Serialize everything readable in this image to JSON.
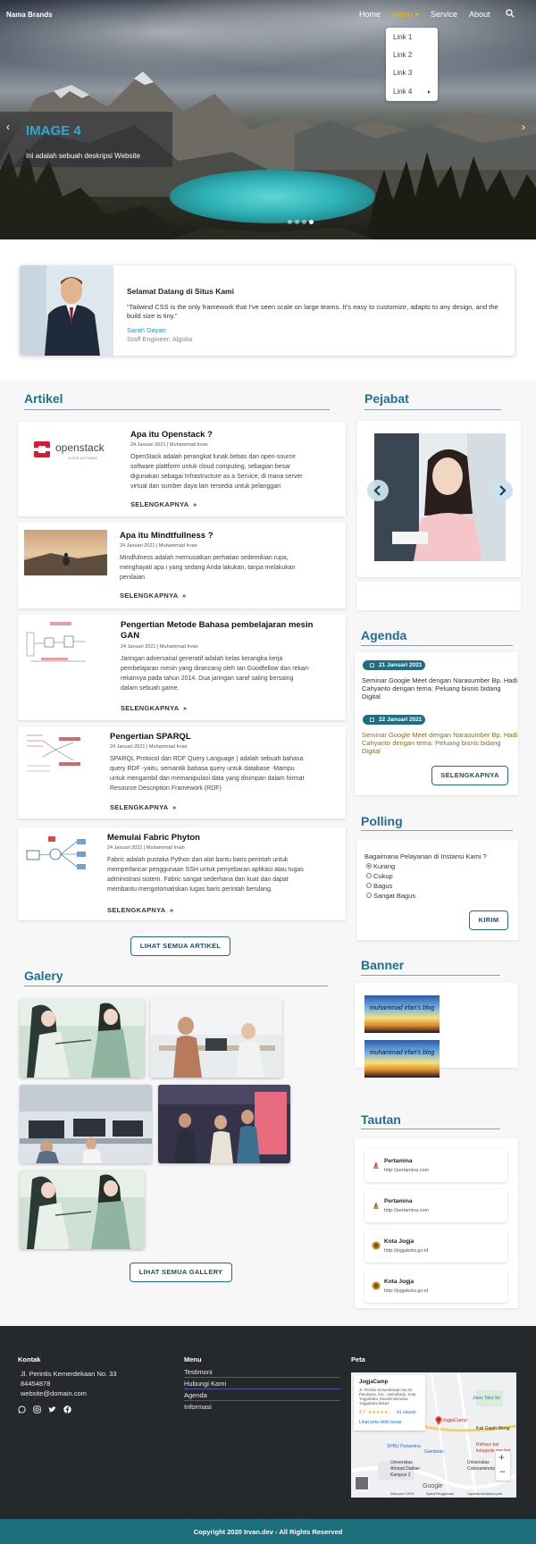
{
  "navbar": {
    "brand": "Nama Brands",
    "links": [
      "Home",
      "Menu",
      "Service",
      "About"
    ],
    "dropdown": [
      "Link 1",
      "Link 2",
      "Link 3",
      "Link 4"
    ]
  },
  "hero": {
    "title": "IMAGE 4",
    "description": "Ini adalah sebuah deskripsi Website",
    "prev": "‹",
    "next": "›",
    "slide_count": 4,
    "active_slide": 4
  },
  "welcome": {
    "title": "Selamat Datang di Situs Kami",
    "quote": "“Tailwind CSS is the only framework that I've seen scale on large teams. It’s easy to customize, adapts to any design, and the build size is tiny.”",
    "name": "Sarah Dayan",
    "role": "Staff Engineer, Algolia"
  },
  "articles_section": {
    "heading": "Artikel",
    "more_label": "SELENGKAPNYA",
    "more_icon": "»",
    "all_button": "LIHAT SEMUA ARTIKEL",
    "items": [
      {
        "title": "Apa itu Openstack ?",
        "meta": "24 Januari 2021 | Muhammad Irvan",
        "desc_lines": [
          "OpenStack adalah perangkat lunak bebas dan open-source",
          "software plattform untuk cloud computing, sebagian besar",
          "digunakan sebagai Infrastructure as a Service, di mana server",
          "virtual dan sumber daya lain tersedia untuk pelanggan"
        ],
        "image": "openstack-logo",
        "logo_text": "openstack",
        "logo_sub": "CLOUD SOFTWARE",
        "more": "SELENGKAPNYA"
      },
      {
        "title": "Apa itu Mindtfullness ?",
        "meta": "24 Januari 2021 | Muhammad Irvan",
        "desc_lines": [
          "Mindfulness adalah memusatkan perhatian sedemikian rupa,",
          "menghayati apa i yang sedang Anda lakukan, tanpa melakukan",
          "penilaian"
        ],
        "image": "meditation-photo",
        "more": "SELENGKAPNYA"
      },
      {
        "title_lines": [
          "Pengertian Metode Bahasa pembelajaran mesin",
          "GAN"
        ],
        "meta": "24 Januari 2021 | Muhammad Irvan",
        "desc_lines": [
          "Jaringan adversarial generatif adalah kelas kerangka kerja",
          "pembelajaran mesin yang dirancang oleh Ian Goodfellow dan rekan-",
          "rekannya pada tahun 2014. Dua jaringan saraf saling bersaing",
          "dalam sebuah game."
        ],
        "image": "gan-diagram",
        "more": "SELENGKAPNYA"
      },
      {
        "title": "Pengertian SPARQL",
        "meta": "24 Januari 2021 | Muhammad Irvan",
        "desc_lines": [
          "SPARQL Protocol dan RDF Query Language ) adalah sebuah bahasa",
          "query RDF -yaitu, semantik bahasa query untuk database -Mampu",
          "untuk mengambil dan memanipulasi data yang disimpan dalam format",
          "Resource Description Framework (RDF)"
        ],
        "image": "sparql-diagram",
        "more": "SELENGKAPNYA"
      },
      {
        "title": "Memulai Fabric Phyton",
        "meta": "24 Januari 2021 | Muhammad Irvan",
        "desc_lines": [
          "Fabric adalah pustaka Python dan alat bantu baris perintah untuk",
          "memperlancar penggunaan SSH untuk penyebaran aplikasi atau tugas",
          "administrasi sistem. Fabric sangat sederhana dan kuat dan dapat",
          "membantu mengotomatiskan tugas baris perintah berulang."
        ],
        "image": "fabric-diagram",
        "more": "SELENGKAPNYA"
      }
    ]
  },
  "gallery": {
    "heading": "Galery",
    "all_button": "LIHAT SEMUA GALLERY"
  },
  "pejabat": {
    "heading": "Pejabat"
  },
  "agenda": {
    "heading": "Agenda",
    "items": [
      {
        "date": "21 Januari 2021",
        "text_lines": [
          "Seminar Google Meet dengan Narasumber Bp. Hadi",
          "Cahyanto dengan tema: Peluang bisnis bidang",
          "Digital"
        ],
        "color": "#333333"
      },
      {
        "date": "22 Januari 2021",
        "text_lines": [
          "Seminar Google Meet dengan Narasumber Bp. Hadi",
          "Cahyanto dengan tema: Peluang bisnis bidang",
          "Digital"
        ],
        "color": "#8a6d1e"
      }
    ],
    "button": "SELENGKAPNYA"
  },
  "polling": {
    "heading": "Polling",
    "question": "Bagaimana Pelayanan di Instansi Kami ?",
    "options": [
      "Kurang",
      "Cukup",
      "Bagus",
      "Sangat Bagus"
    ],
    "selected": 0,
    "button": "KIRIM"
  },
  "banner": {
    "heading": "Banner",
    "items": [
      "muhammad irfan's blog",
      "muhammad irfan's blog"
    ]
  },
  "tautan": {
    "heading": "Tautan",
    "items": [
      {
        "name": "Pertamina",
        "url": "http://pertamina.com",
        "icon": "pertamina-icon"
      },
      {
        "name": "Pertamina",
        "url": "http://pertamina.com",
        "icon": "pertamina-icon"
      },
      {
        "name": "Kota Jogja",
        "url": "http://jogjakota.go.id",
        "icon": "jogja-icon"
      },
      {
        "name": "Kota Jogja",
        "url": "http://jogjakota.go.id",
        "icon": "jogja-icon"
      }
    ]
  },
  "footer": {
    "kontak": {
      "heading": "Kontak",
      "address": "Jl. Perintis Kemerdekaan No. 33",
      "phone": "84454878",
      "email": "website@domain.com"
    },
    "socials": [
      "whatsapp-icon",
      "instagram-icon",
      "twitter-icon",
      "facebook-icon"
    ],
    "menu": {
      "heading": "Menu",
      "items": [
        "Testimoni",
        "Hubungi Kami",
        "Agenda",
        "Informasi"
      ]
    },
    "peta": {
      "heading": "Peta",
      "place": "JogjaCamp",
      "address_lines": [
        "Jl. Perintis Kemerdekaan No.33,",
        "Pandeyan, Kec. Umbulharjo, Kota",
        "Yogyakarta, Daerah Istimewa",
        "Yogyakarta 55161"
      ],
      "rating": "4,7",
      "stars": "★★★★★",
      "reviews": "41 ulasan",
      "larger_map": "Lihat peta lebih besar",
      "labels": [
        "Joins Toko Se",
        "Kali Gajah Wong",
        "Rahayu bar",
        "kotagede meubel",
        "SPBU Pertamina",
        "Gambiran",
        "Universitas",
        "Ahmad Dahlan",
        "Kampus 2",
        "Universitas",
        "Cokroaminoto",
        "JogjaCamp"
      ],
      "attribution": "Data peta ©2025",
      "terms": "Syarat Penggunaan",
      "report": "Laporkan kesalahan peta",
      "google": "Google",
      "zoom_in": "+",
      "zoom_out": "−"
    },
    "copyright": "Copyright 2020 Irvan.dev - All Rights Reserved"
  }
}
